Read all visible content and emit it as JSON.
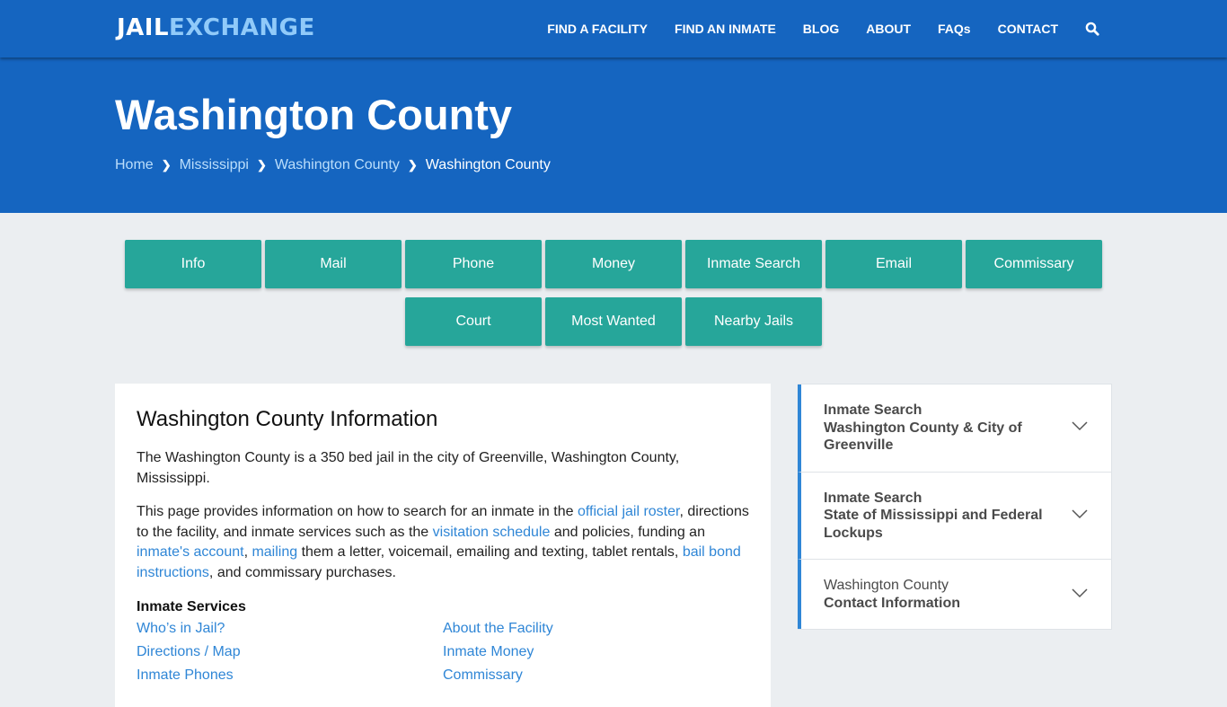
{
  "header": {
    "logo_part1": "JAIL",
    "logo_part2": "EXCHANGE",
    "nav": [
      "FIND A FACILITY",
      "FIND AN INMATE",
      "BLOG",
      "ABOUT",
      "FAQs",
      "CONTACT"
    ],
    "search_icon": "search-icon"
  },
  "hero": {
    "title": "Washington County",
    "breadcrumb": [
      "Home",
      "Mississippi",
      "Washington County",
      "Washington County"
    ]
  },
  "tabs": {
    "row1": [
      "Info",
      "Mail",
      "Phone",
      "Money",
      "Inmate Search",
      "Email",
      "Commissary"
    ],
    "row2": [
      "Court",
      "Most Wanted",
      "Nearby Jails"
    ]
  },
  "main": {
    "title": "Washington County Information",
    "para1": "The Washington County is a 350 bed jail in the city of Greenville, Washington County, Mississippi.",
    "para2": {
      "t1": "This page provides information on how to search for an inmate in the ",
      "l1": "official jail roster",
      "t2": ", directions to the facility, and inmate services such as the ",
      "l2": "visitation schedule",
      "t3": " and policies, funding an ",
      "l3": "inmate's account",
      "t4": ", ",
      "l4": "mailing",
      "t5": " them a letter, voicemail, emailing and texting, tablet rentals, ",
      "l5": "bail bond instructions",
      "t6": ", and commissary purchases."
    },
    "services_title": "Inmate Services",
    "services": [
      "Who’s in Jail?",
      "About the Facility",
      "Directions / Map",
      "Inmate Money",
      "Inmate Phones",
      "Commissary"
    ]
  },
  "sidebar": {
    "items": [
      {
        "line1": "Inmate Search",
        "line2": "Washington County & City of Greenville"
      },
      {
        "line1": "Inmate Search",
        "line2": "State of Mississippi and Federal Lockups"
      },
      {
        "line1": "Washington County",
        "line2": "Contact Information"
      }
    ]
  },
  "colors": {
    "brand_blue": "#1565c0",
    "logo_accent": "#90caf9",
    "tab_teal": "#26a69a",
    "link_blue": "#2f86d6",
    "page_bg": "#ebeef1"
  }
}
